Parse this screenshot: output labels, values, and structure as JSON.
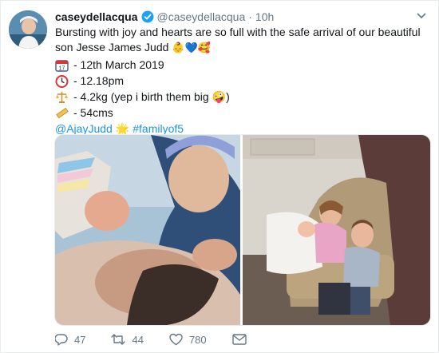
{
  "tweet": {
    "display_name": "caseydellacqua",
    "handle": "@caseydellacqua",
    "separator": "·",
    "time": "10h",
    "text_intro": "Bursting with joy and hearts are so full with the safe arrival of our beautiful son Jesse James Judd",
    "intro_emojis": "👶💙🥰",
    "lines": [
      {
        "icon": "calendar-icon",
        "glyph": "📆",
        "text": "- 12th March 2019"
      },
      {
        "icon": "clock-icon",
        "glyph": "⏰",
        "text": "- 12.18pm"
      },
      {
        "icon": "scales-icon",
        "glyph": "⚖️",
        "text": "- 4.2kg (yep i birth them big",
        "trail": "🤪)"
      },
      {
        "icon": "ruler-icon",
        "glyph": "📏",
        "text": "- 54cms"
      }
    ],
    "mention": "@AjayJudd",
    "star_emoji": "🌟",
    "hashtag": "#familyof5"
  },
  "actions": {
    "replies": "47",
    "retweets": "44",
    "likes": "780"
  },
  "colors": {
    "link": "#1b95e0",
    "muted": "#657786",
    "verified": "#1da1f2"
  }
}
